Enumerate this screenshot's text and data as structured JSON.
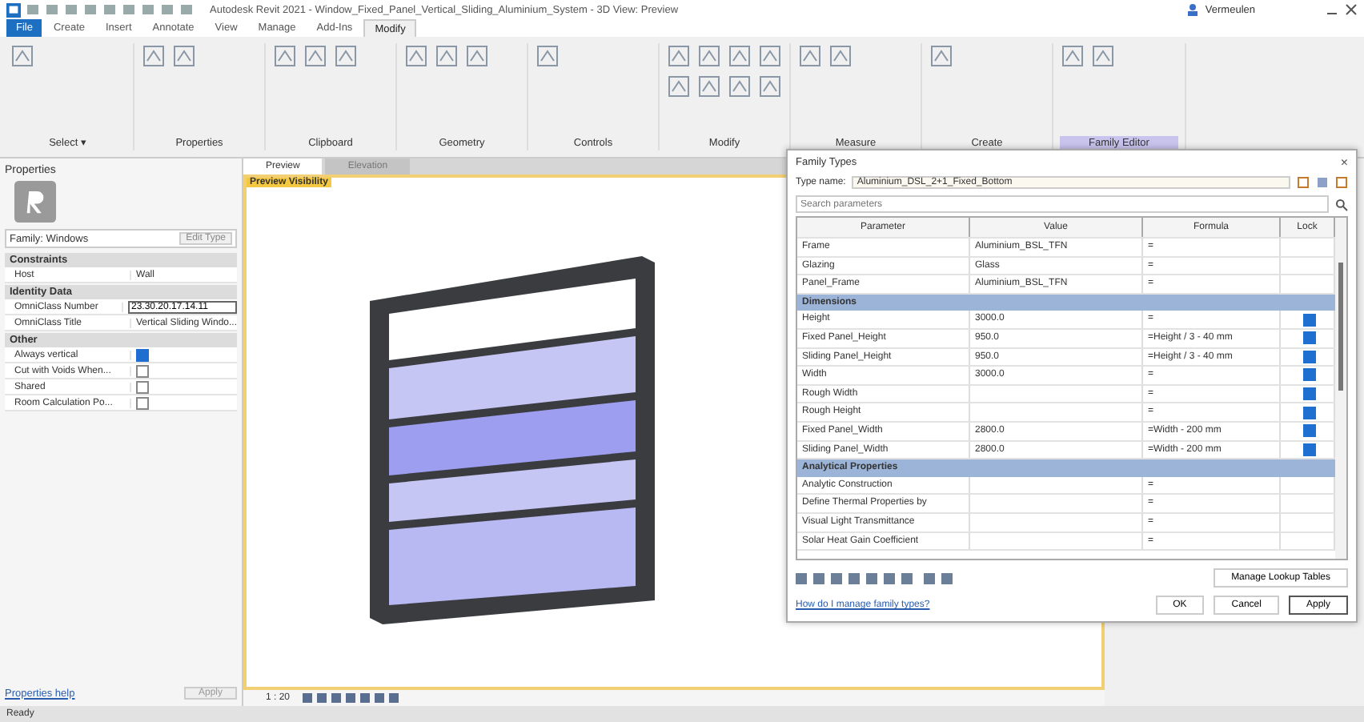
{
  "window": {
    "title": "Autodesk Revit 2021 - Window_Fixed_Panel_Vertical_Sliding_Aluminium_System - 3D View: Preview"
  },
  "user": {
    "name": "Vermeulen"
  },
  "ribbon": {
    "tabs": [
      {
        "label": "File",
        "selected": false,
        "kind": "file"
      },
      {
        "label": "Create",
        "selected": false
      },
      {
        "label": "Insert",
        "selected": false
      },
      {
        "label": "Annotate",
        "selected": false
      },
      {
        "label": "View",
        "selected": false
      },
      {
        "label": "Manage",
        "selected": false
      },
      {
        "label": "Add-Ins",
        "selected": false
      },
      {
        "label": "Modify",
        "selected": true
      }
    ],
    "panels": [
      {
        "label": "Select ▾",
        "highlighted": false
      },
      {
        "label": "Properties",
        "highlighted": false
      },
      {
        "label": "Clipboard",
        "highlighted": false
      },
      {
        "label": "Geometry",
        "highlighted": false
      },
      {
        "label": "Controls",
        "highlighted": false
      },
      {
        "label": "Modify",
        "highlighted": false
      },
      {
        "label": "Measure",
        "highlighted": false
      },
      {
        "label": "Create",
        "highlighted": false
      },
      {
        "label": "Family Editor",
        "highlighted": true
      }
    ]
  },
  "properties": {
    "title": "Properties",
    "family": "Family: Windows",
    "edit_type": "Edit Type",
    "groups": [
      {
        "label": "Constraints",
        "rows": [
          {
            "name": "Host",
            "value": "Wall",
            "kind": "text"
          }
        ]
      },
      {
        "label": "Identity Data",
        "rows": [
          {
            "name": "OmniClass Number",
            "value": "23.30.20.17.14.11",
            "kind": "field"
          },
          {
            "name": "OmniClass Title",
            "value": "Vertical Sliding Windo...",
            "kind": "text"
          }
        ]
      },
      {
        "label": "Other",
        "rows": [
          {
            "name": "Always vertical",
            "kind": "check",
            "checked": true
          },
          {
            "name": "Cut with Voids When...",
            "kind": "check",
            "checked": false
          },
          {
            "name": "Shared",
            "kind": "check",
            "checked": false
          },
          {
            "name": "Room Calculation Po...",
            "kind": "check",
            "checked": false
          }
        ]
      }
    ],
    "help": "Properties help",
    "apply": "Apply"
  },
  "view": {
    "tabs": [
      {
        "label": "Preview",
        "selected": true
      },
      {
        "label": "Elevation",
        "selected": false
      }
    ],
    "label": "Preview Visibility",
    "scale": "1 : 20"
  },
  "dialog": {
    "title": "Family Types",
    "close": "×",
    "type_name_label": "Type name:",
    "type_name": "Aluminium_DSL_2+1_Fixed_Bottom",
    "search": {
      "placeholder": "Search parameters"
    },
    "columns": [
      "Parameter",
      "Value",
      "Formula",
      "Lock"
    ],
    "rows": [
      {
        "kind": "param",
        "parameter": "Frame",
        "value": "Aluminium_BSL_TFN",
        "formula": "="
      },
      {
        "kind": "param",
        "parameter": "Glazing",
        "value": "Glass",
        "formula": "="
      },
      {
        "kind": "param",
        "parameter": "Panel_Frame",
        "value": "Aluminium_BSL_TFN",
        "formula": "="
      },
      {
        "kind": "group",
        "parameter": "Dimensions"
      },
      {
        "kind": "param",
        "parameter": "Height",
        "value": "3000.0",
        "formula": "=",
        "locked": true
      },
      {
        "kind": "param",
        "parameter": "Fixed Panel_Height",
        "value": "950.0",
        "formula": "=Height / 3 - 40 mm",
        "locked": true
      },
      {
        "kind": "param",
        "parameter": "Sliding Panel_Height",
        "value": "950.0",
        "formula": "=Height / 3 - 40 mm",
        "locked": true
      },
      {
        "kind": "param",
        "parameter": "Width",
        "value": "3000.0",
        "formula": "=",
        "locked": true
      },
      {
        "kind": "param",
        "parameter": "Rough Width",
        "formula": "=",
        "locked": true
      },
      {
        "kind": "param",
        "parameter": "Rough Height",
        "formula": "=",
        "locked": true
      },
      {
        "kind": "param",
        "parameter": "Fixed Panel_Width",
        "value": "2800.0",
        "formula": "=Width - 200 mm",
        "locked": true
      },
      {
        "kind": "param",
        "parameter": "Sliding Panel_Width",
        "value": "2800.0",
        "formula": "=Width - 200 mm",
        "locked": true
      },
      {
        "kind": "group",
        "parameter": "Analytical Properties"
      },
      {
        "kind": "param",
        "parameter": "Analytic Construction",
        "formula": "="
      },
      {
        "kind": "param",
        "parameter": "Define Thermal Properties by",
        "formula": "="
      },
      {
        "kind": "param",
        "parameter": "Visual Light Transmittance",
        "formula": "="
      },
      {
        "kind": "param",
        "parameter": "Solar Heat Gain Coefficient",
        "formula": "="
      }
    ],
    "lookup": "Manage Lookup Tables",
    "link": "How do I manage family types?",
    "buttons": [
      "OK",
      "Cancel",
      "Apply"
    ]
  },
  "status_bar": {
    "text": "Ready"
  }
}
